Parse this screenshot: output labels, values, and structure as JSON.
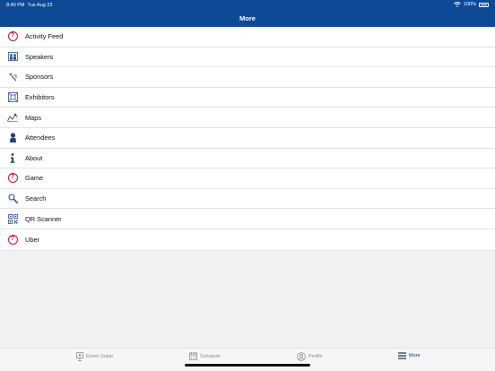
{
  "status": {
    "time": "8:40 PM",
    "date": "Tue Aug 23",
    "battery": "100%"
  },
  "header": {
    "title": "More"
  },
  "menu": [
    {
      "label": "Activity Feed",
      "icon": "question-icon"
    },
    {
      "label": "Speakers",
      "icon": "speakers-icon"
    },
    {
      "label": "Sponsors",
      "icon": "sponsors-icon"
    },
    {
      "label": "Exhibitors",
      "icon": "exhibitors-icon"
    },
    {
      "label": "Maps",
      "icon": "map-icon"
    },
    {
      "label": "Attendees",
      "icon": "attendee-icon"
    },
    {
      "label": "About",
      "icon": "info-icon"
    },
    {
      "label": "Game",
      "icon": "question-icon"
    },
    {
      "label": "Search",
      "icon": "search-icon"
    },
    {
      "label": "QR Scanner",
      "icon": "qr-icon"
    },
    {
      "label": "Uber",
      "icon": "question-icon"
    }
  ],
  "tabs": [
    {
      "label": "Event Guide",
      "icon": "guide-icon"
    },
    {
      "label": "Schedule",
      "icon": "calendar-icon"
    },
    {
      "label": "Profile",
      "icon": "profile-icon"
    },
    {
      "label": "More",
      "icon": "menu-icon"
    }
  ],
  "colors": {
    "header": "#0d4a96",
    "accent_red": "#c8102e",
    "icon_blue": "#2a4d8f"
  }
}
